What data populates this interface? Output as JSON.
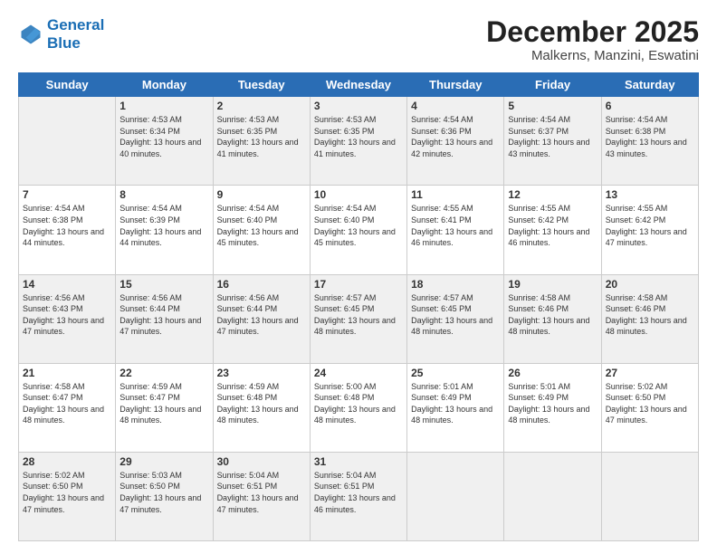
{
  "header": {
    "logo_line1": "General",
    "logo_line2": "Blue",
    "month": "December 2025",
    "location": "Malkerns, Manzini, Eswatini"
  },
  "weekdays": [
    "Sunday",
    "Monday",
    "Tuesday",
    "Wednesday",
    "Thursday",
    "Friday",
    "Saturday"
  ],
  "weeks": [
    [
      {
        "day": null,
        "info": null
      },
      {
        "day": "1",
        "info": "Sunrise: 4:53 AM\nSunset: 6:34 PM\nDaylight: 13 hours\nand 40 minutes."
      },
      {
        "day": "2",
        "info": "Sunrise: 4:53 AM\nSunset: 6:35 PM\nDaylight: 13 hours\nand 41 minutes."
      },
      {
        "day": "3",
        "info": "Sunrise: 4:53 AM\nSunset: 6:35 PM\nDaylight: 13 hours\nand 41 minutes."
      },
      {
        "day": "4",
        "info": "Sunrise: 4:54 AM\nSunset: 6:36 PM\nDaylight: 13 hours\nand 42 minutes."
      },
      {
        "day": "5",
        "info": "Sunrise: 4:54 AM\nSunset: 6:37 PM\nDaylight: 13 hours\nand 43 minutes."
      },
      {
        "day": "6",
        "info": "Sunrise: 4:54 AM\nSunset: 6:38 PM\nDaylight: 13 hours\nand 43 minutes."
      }
    ],
    [
      {
        "day": "7",
        "info": "Sunrise: 4:54 AM\nSunset: 6:38 PM\nDaylight: 13 hours\nand 44 minutes."
      },
      {
        "day": "8",
        "info": "Sunrise: 4:54 AM\nSunset: 6:39 PM\nDaylight: 13 hours\nand 44 minutes."
      },
      {
        "day": "9",
        "info": "Sunrise: 4:54 AM\nSunset: 6:40 PM\nDaylight: 13 hours\nand 45 minutes."
      },
      {
        "day": "10",
        "info": "Sunrise: 4:54 AM\nSunset: 6:40 PM\nDaylight: 13 hours\nand 45 minutes."
      },
      {
        "day": "11",
        "info": "Sunrise: 4:55 AM\nSunset: 6:41 PM\nDaylight: 13 hours\nand 46 minutes."
      },
      {
        "day": "12",
        "info": "Sunrise: 4:55 AM\nSunset: 6:42 PM\nDaylight: 13 hours\nand 46 minutes."
      },
      {
        "day": "13",
        "info": "Sunrise: 4:55 AM\nSunset: 6:42 PM\nDaylight: 13 hours\nand 47 minutes."
      }
    ],
    [
      {
        "day": "14",
        "info": "Sunrise: 4:56 AM\nSunset: 6:43 PM\nDaylight: 13 hours\nand 47 minutes."
      },
      {
        "day": "15",
        "info": "Sunrise: 4:56 AM\nSunset: 6:44 PM\nDaylight: 13 hours\nand 47 minutes."
      },
      {
        "day": "16",
        "info": "Sunrise: 4:56 AM\nSunset: 6:44 PM\nDaylight: 13 hours\nand 47 minutes."
      },
      {
        "day": "17",
        "info": "Sunrise: 4:57 AM\nSunset: 6:45 PM\nDaylight: 13 hours\nand 48 minutes."
      },
      {
        "day": "18",
        "info": "Sunrise: 4:57 AM\nSunset: 6:45 PM\nDaylight: 13 hours\nand 48 minutes."
      },
      {
        "day": "19",
        "info": "Sunrise: 4:58 AM\nSunset: 6:46 PM\nDaylight: 13 hours\nand 48 minutes."
      },
      {
        "day": "20",
        "info": "Sunrise: 4:58 AM\nSunset: 6:46 PM\nDaylight: 13 hours\nand 48 minutes."
      }
    ],
    [
      {
        "day": "21",
        "info": "Sunrise: 4:58 AM\nSunset: 6:47 PM\nDaylight: 13 hours\nand 48 minutes."
      },
      {
        "day": "22",
        "info": "Sunrise: 4:59 AM\nSunset: 6:47 PM\nDaylight: 13 hours\nand 48 minutes."
      },
      {
        "day": "23",
        "info": "Sunrise: 4:59 AM\nSunset: 6:48 PM\nDaylight: 13 hours\nand 48 minutes."
      },
      {
        "day": "24",
        "info": "Sunrise: 5:00 AM\nSunset: 6:48 PM\nDaylight: 13 hours\nand 48 minutes."
      },
      {
        "day": "25",
        "info": "Sunrise: 5:01 AM\nSunset: 6:49 PM\nDaylight: 13 hours\nand 48 minutes."
      },
      {
        "day": "26",
        "info": "Sunrise: 5:01 AM\nSunset: 6:49 PM\nDaylight: 13 hours\nand 48 minutes."
      },
      {
        "day": "27",
        "info": "Sunrise: 5:02 AM\nSunset: 6:50 PM\nDaylight: 13 hours\nand 47 minutes."
      }
    ],
    [
      {
        "day": "28",
        "info": "Sunrise: 5:02 AM\nSunset: 6:50 PM\nDaylight: 13 hours\nand 47 minutes."
      },
      {
        "day": "29",
        "info": "Sunrise: 5:03 AM\nSunset: 6:50 PM\nDaylight: 13 hours\nand 47 minutes."
      },
      {
        "day": "30",
        "info": "Sunrise: 5:04 AM\nSunset: 6:51 PM\nDaylight: 13 hours\nand 47 minutes."
      },
      {
        "day": "31",
        "info": "Sunrise: 5:04 AM\nSunset: 6:51 PM\nDaylight: 13 hours\nand 46 minutes."
      },
      {
        "day": null,
        "info": null
      },
      {
        "day": null,
        "info": null
      },
      {
        "day": null,
        "info": null
      }
    ]
  ]
}
